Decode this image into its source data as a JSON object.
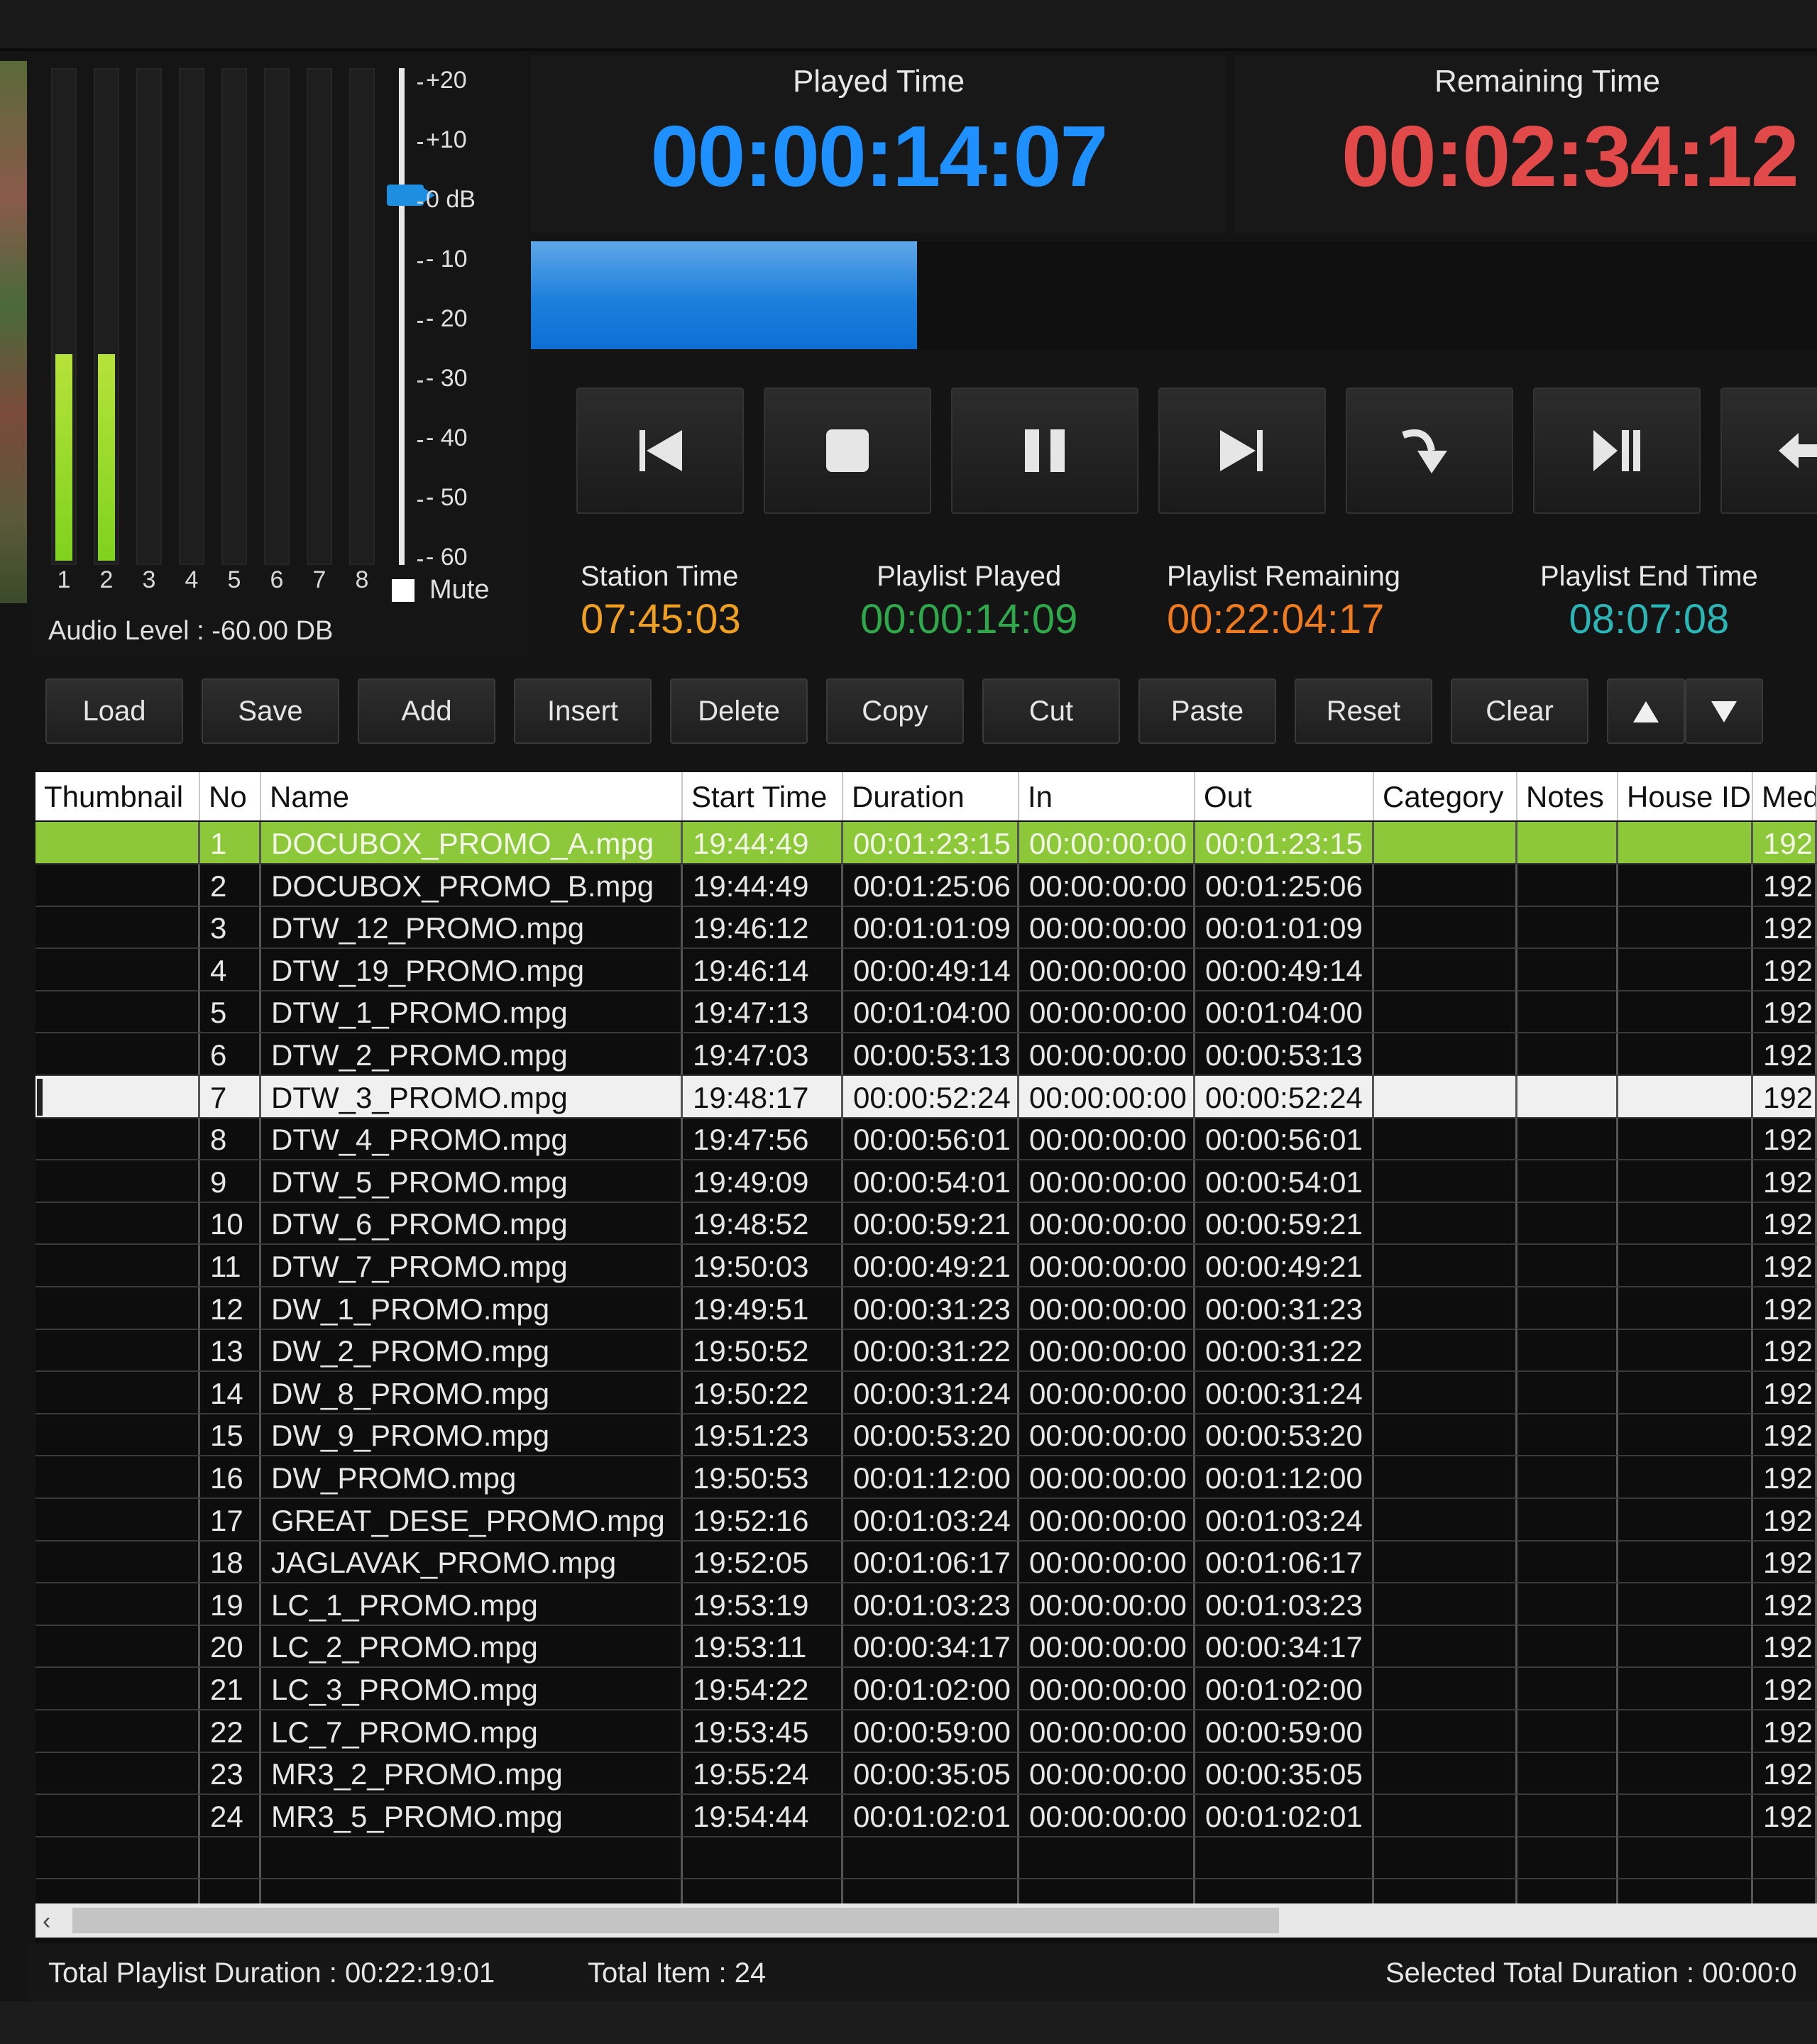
{
  "audio": {
    "meters": [
      {
        "label": "1",
        "level": 0.42
      },
      {
        "label": "2",
        "level": 0.42
      },
      {
        "label": "3",
        "level": 0
      },
      {
        "label": "4",
        "level": 0
      },
      {
        "label": "5",
        "level": 0
      },
      {
        "label": "6",
        "level": 0
      },
      {
        "label": "7",
        "level": 0
      },
      {
        "label": "8",
        "level": 0
      }
    ],
    "db_scale": [
      "+20",
      "+10",
      "0 dB",
      "- 10",
      "- 20",
      "- 30",
      "- 40",
      "- 50",
      "- 60"
    ],
    "mute_label": "Mute",
    "audio_level_text": "Audio Level :  -60.00  DB"
  },
  "timers": {
    "played_title": "Played Time",
    "played_value": "00:00:14:07",
    "remaining_title": "Remaining Time",
    "remaining_value": "00:02:34:12",
    "played_color": "#1e90ff",
    "remaining_color": "#e24a4a",
    "progress_fraction": 0.3
  },
  "transport": {
    "buttons": [
      "previous-icon",
      "stop-icon",
      "pause-icon",
      "next-icon",
      "skip-icon",
      "play-pause-icon",
      "back-icon"
    ]
  },
  "stats": {
    "station_time_label": "Station Time",
    "station_time_value": "07:45:03",
    "playlist_played_label": "Playlist Played",
    "playlist_played_value": "00:00:14:09",
    "playlist_remaining_label": "Playlist Remaining",
    "playlist_remaining_value": "00:22:04:17",
    "playlist_end_label": "Playlist End Time",
    "playlist_end_value": "08:07:08",
    "colors": {
      "station": "#f0a020",
      "played": "#2ea84a",
      "remaining": "#f07a1e",
      "end": "#2ab6b6"
    }
  },
  "toolbar": {
    "load": "Load",
    "save": "Save",
    "add": "Add",
    "insert": "Insert",
    "delete": "Delete",
    "copy": "Copy",
    "cut": "Cut",
    "paste": "Paste",
    "reset": "Reset",
    "clear": "Clear"
  },
  "table": {
    "columns": [
      "Thumbnail",
      "No",
      "Name",
      "Start Time",
      "Duration",
      "In",
      "Out",
      "Category",
      "Notes",
      "House ID",
      "Med"
    ],
    "rows": [
      {
        "no": "1",
        "name": "DOCUBOX_PROMO_A.mpg",
        "start": "19:44:49",
        "duration": "00:01:23:15",
        "in": "00:00:00:00",
        "out": "00:01:23:15",
        "med": "192"
      },
      {
        "no": "2",
        "name": "DOCUBOX_PROMO_B.mpg",
        "start": "19:44:49",
        "duration": "00:01:25:06",
        "in": "00:00:00:00",
        "out": "00:01:25:06",
        "med": "192"
      },
      {
        "no": "3",
        "name": "DTW_12_PROMO.mpg",
        "start": "19:46:12",
        "duration": "00:01:01:09",
        "in": "00:00:00:00",
        "out": "00:01:01:09",
        "med": "192"
      },
      {
        "no": "4",
        "name": "DTW_19_PROMO.mpg",
        "start": "19:46:14",
        "duration": "00:00:49:14",
        "in": "00:00:00:00",
        "out": "00:00:49:14",
        "med": "192"
      },
      {
        "no": "5",
        "name": "DTW_1_PROMO.mpg",
        "start": "19:47:13",
        "duration": "00:01:04:00",
        "in": "00:00:00:00",
        "out": "00:01:04:00",
        "med": "192"
      },
      {
        "no": "6",
        "name": "DTW_2_PROMO.mpg",
        "start": "19:47:03",
        "duration": "00:00:53:13",
        "in": "00:00:00:00",
        "out": "00:00:53:13",
        "med": "192"
      },
      {
        "no": "7",
        "name": "DTW_3_PROMO.mpg",
        "start": "19:48:17",
        "duration": "00:00:52:24",
        "in": "00:00:00:00",
        "out": "00:00:52:24",
        "med": "192"
      },
      {
        "no": "8",
        "name": "DTW_4_PROMO.mpg",
        "start": "19:47:56",
        "duration": "00:00:56:01",
        "in": "00:00:00:00",
        "out": "00:00:56:01",
        "med": "192"
      },
      {
        "no": "9",
        "name": "DTW_5_PROMO.mpg",
        "start": "19:49:09",
        "duration": "00:00:54:01",
        "in": "00:00:00:00",
        "out": "00:00:54:01",
        "med": "192"
      },
      {
        "no": "10",
        "name": "DTW_6_PROMO.mpg",
        "start": "19:48:52",
        "duration": "00:00:59:21",
        "in": "00:00:00:00",
        "out": "00:00:59:21",
        "med": "192"
      },
      {
        "no": "11",
        "name": "DTW_7_PROMO.mpg",
        "start": "19:50:03",
        "duration": "00:00:49:21",
        "in": "00:00:00:00",
        "out": "00:00:49:21",
        "med": "192"
      },
      {
        "no": "12",
        "name": "DW_1_PROMO.mpg",
        "start": "19:49:51",
        "duration": "00:00:31:23",
        "in": "00:00:00:00",
        "out": "00:00:31:23",
        "med": "192"
      },
      {
        "no": "13",
        "name": "DW_2_PROMO.mpg",
        "start": "19:50:52",
        "duration": "00:00:31:22",
        "in": "00:00:00:00",
        "out": "00:00:31:22",
        "med": "192"
      },
      {
        "no": "14",
        "name": "DW_8_PROMO.mpg",
        "start": "19:50:22",
        "duration": "00:00:31:24",
        "in": "00:00:00:00",
        "out": "00:00:31:24",
        "med": "192"
      },
      {
        "no": "15",
        "name": "DW_9_PROMO.mpg",
        "start": "19:51:23",
        "duration": "00:00:53:20",
        "in": "00:00:00:00",
        "out": "00:00:53:20",
        "med": "192"
      },
      {
        "no": "16",
        "name": "DW_PROMO.mpg",
        "start": "19:50:53",
        "duration": "00:01:12:00",
        "in": "00:00:00:00",
        "out": "00:01:12:00",
        "med": "192"
      },
      {
        "no": "17",
        "name": "GREAT_DESE_PROMO.mpg",
        "start": "19:52:16",
        "duration": "00:01:03:24",
        "in": "00:00:00:00",
        "out": "00:01:03:24",
        "med": "192"
      },
      {
        "no": "18",
        "name": "JAGLAVAK_PROMO.mpg",
        "start": "19:52:05",
        "duration": "00:01:06:17",
        "in": "00:00:00:00",
        "out": "00:01:06:17",
        "med": "192"
      },
      {
        "no": "19",
        "name": "LC_1_PROMO.mpg",
        "start": "19:53:19",
        "duration": "00:01:03:23",
        "in": "00:00:00:00",
        "out": "00:01:03:23",
        "med": "192"
      },
      {
        "no": "20",
        "name": "LC_2_PROMO.mpg",
        "start": "19:53:11",
        "duration": "00:00:34:17",
        "in": "00:00:00:00",
        "out": "00:00:34:17",
        "med": "192"
      },
      {
        "no": "21",
        "name": "LC_3_PROMO.mpg",
        "start": "19:54:22",
        "duration": "00:01:02:00",
        "in": "00:00:00:00",
        "out": "00:01:02:00",
        "med": "192"
      },
      {
        "no": "22",
        "name": "LC_7_PROMO.mpg",
        "start": "19:53:45",
        "duration": "00:00:59:00",
        "in": "00:00:00:00",
        "out": "00:00:59:00",
        "med": "192"
      },
      {
        "no": "23",
        "name": "MR3_2_PROMO.mpg",
        "start": "19:55:24",
        "duration": "00:00:35:05",
        "in": "00:00:00:00",
        "out": "00:00:35:05",
        "med": "192"
      },
      {
        "no": "24",
        "name": "MR3_5_PROMO.mpg",
        "start": "19:54:44",
        "duration": "00:01:02:01",
        "in": "00:00:00:00",
        "out": "00:01:02:01",
        "med": "192"
      }
    ],
    "playing_row": 0,
    "selected_row": 6,
    "playing_color": "#8cc83a"
  },
  "status": {
    "total_duration": "Total Playlist Duration :  00:22:19:01",
    "total_items": "Total Item :  24",
    "selected_duration": "Selected Total Duration :  00:00:0"
  }
}
